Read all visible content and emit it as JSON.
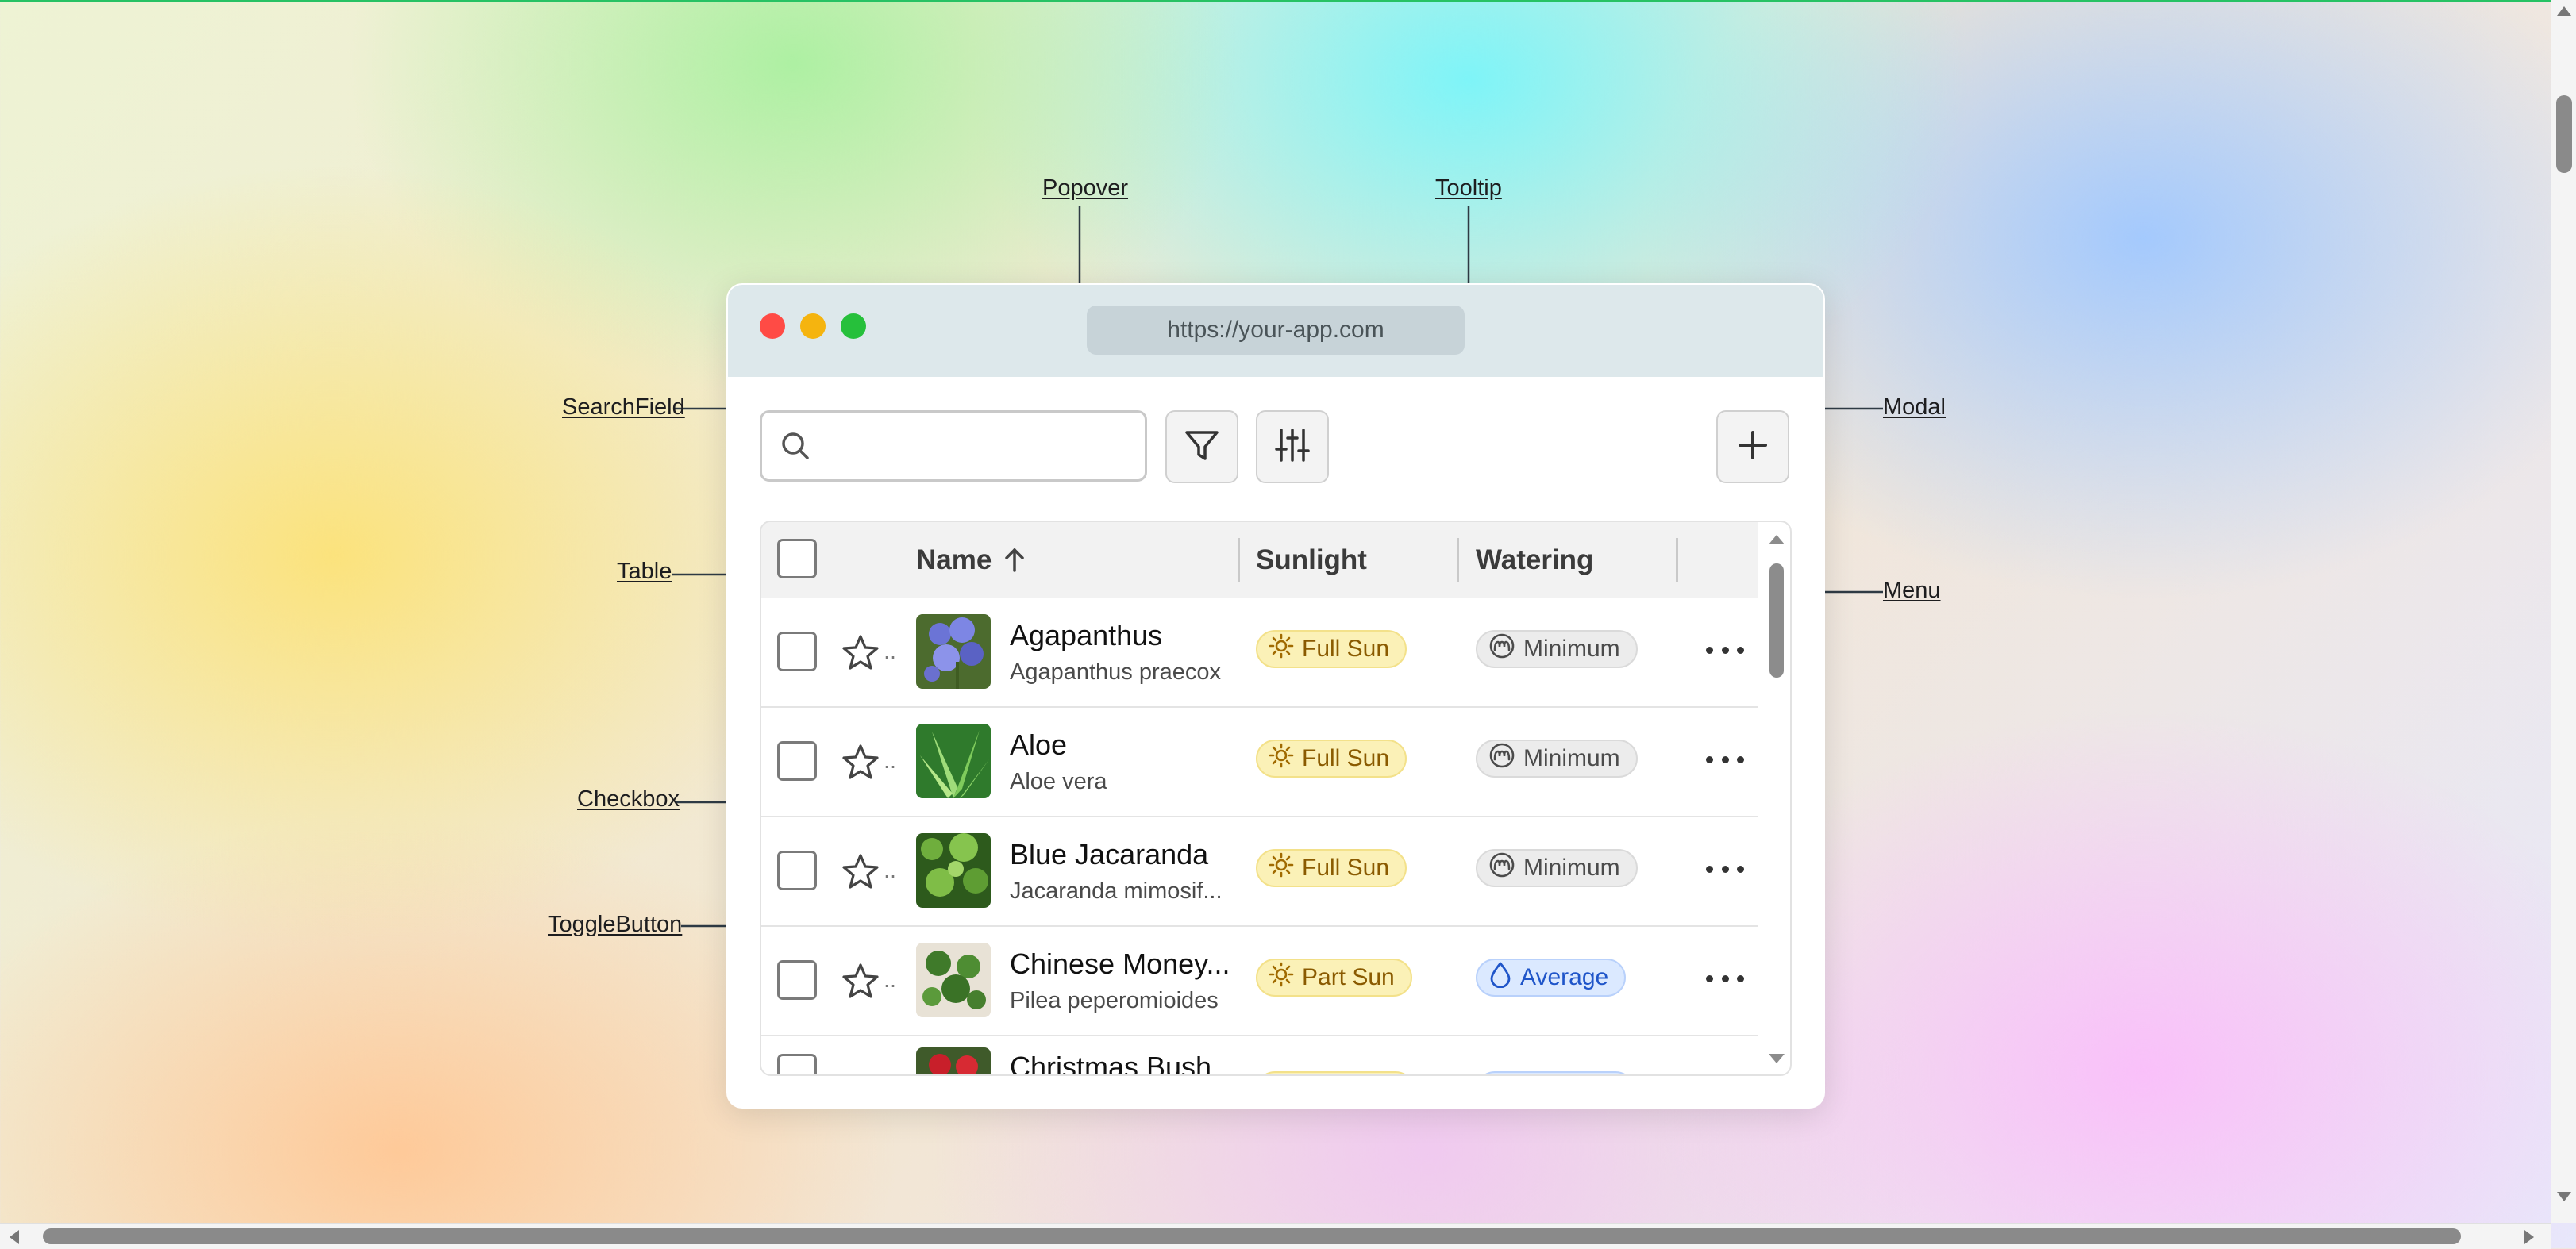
{
  "window": {
    "url": "https://your-app.com"
  },
  "callouts": {
    "popover": "Popover",
    "tooltip": "Tooltip",
    "search_field": "SearchField",
    "modal": "Modal",
    "table": "Table",
    "menu": "Menu",
    "checkbox": "Checkbox",
    "toggle_button": "ToggleButton"
  },
  "table": {
    "columns": [
      {
        "label": "Name",
        "sort": "ascending"
      },
      {
        "label": "Sunlight"
      },
      {
        "label": "Watering"
      }
    ],
    "rows": [
      {
        "name": "Agapanthus",
        "scientific": "Agapanthus praecox",
        "sunlight": "Full Sun",
        "watering": "Minimum",
        "watering_level": "min"
      },
      {
        "name": "Aloe",
        "scientific": "Aloe vera",
        "sunlight": "Full Sun",
        "watering": "Minimum",
        "watering_level": "min"
      },
      {
        "name": "Blue Jacaranda",
        "scientific": "Jacaranda mimosif...",
        "sunlight": "Full Sun",
        "watering": "Minimum",
        "watering_level": "min"
      },
      {
        "name": "Chinese Money...",
        "scientific": "Pilea peperomioides",
        "sunlight": "Part Sun",
        "watering": "Average",
        "watering_level": "avg"
      },
      {
        "name": "Christmas Bush",
        "scientific": "",
        "sunlight": "",
        "watering": "",
        "watering_level": ""
      }
    ]
  },
  "icons": {
    "search": "search-icon",
    "filter": "filter-icon",
    "settings": "sliders-icon",
    "add": "plus-icon",
    "favorite": "star-icon",
    "more": "more-icon",
    "sun": "sun-icon",
    "water_min": "water-min-icon",
    "water_avg": "droplet-icon"
  },
  "colors": {
    "traffic_red": "#ff4b45",
    "traffic_yellow": "#f5b40f",
    "traffic_green": "#26c03b",
    "sun_badge_bg": "#fbf1b7",
    "water_avg_badge_bg": "#dbe9ff"
  }
}
